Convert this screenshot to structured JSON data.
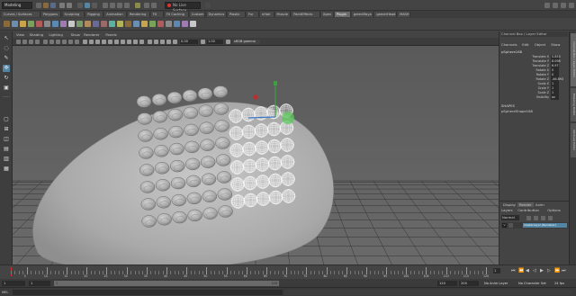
{
  "statusline": {
    "mode": "Modeling",
    "live_surface": "No Live Surface"
  },
  "shelf_tabs": [
    "Curves / Surfaces",
    "Polygons",
    "Sculpting",
    "Rigging",
    "Animation",
    "Rendering",
    "FX",
    "FX Caching",
    "Custom",
    "Dynamics",
    "Plastic",
    "Fur",
    "nHair",
    "Muscle",
    "PaintEffects",
    "Xgen",
    "Plugin",
    "greenMaya",
    "gamerHead",
    "MASH"
  ],
  "panel_menu": [
    "View",
    "Shading",
    "Lighting",
    "Show",
    "Renderer",
    "Panels"
  ],
  "panel_bar": {
    "value_a": "0.00",
    "value_b": "1.00",
    "color_space": "sRGB gamma"
  },
  "channel_box": {
    "header_title": "Channel Box / Layer Editor",
    "menus": [
      "Channels",
      "Edit",
      "Object",
      "Show"
    ],
    "object_name": "pSphere168",
    "attributes": [
      {
        "label": "Translate X",
        "value": "5.853"
      },
      {
        "label": "Translate Y",
        "value": "8.098"
      },
      {
        "label": "Translate Z",
        "value": "6.97"
      },
      {
        "label": "Rotate X",
        "value": "0"
      },
      {
        "label": "Rotate Y",
        "value": "0"
      },
      {
        "label": "Rotate Z",
        "value": "-46.893"
      },
      {
        "label": "Scale X",
        "value": "1"
      },
      {
        "label": "Scale Y",
        "value": "1"
      },
      {
        "label": "Scale Z",
        "value": "1"
      },
      {
        "label": "Visibility",
        "value": "on"
      }
    ],
    "shapes_label": "SHAPES",
    "shape_name": "pSphereShape168"
  },
  "layer_editor": {
    "tabs": [
      "Display",
      "Render",
      "Anim"
    ],
    "menus": [
      "Layers",
      "Contribution",
      "Options"
    ],
    "blend_mode": "Normal",
    "layer_name": "masterLayer (Renderer)"
  },
  "side_tabs": [
    "Channel Box / Layer Editor",
    "Modeling Toolkit",
    "Attribute Editor"
  ],
  "time_slider": {
    "ticks": [
      "5",
      "10",
      "15",
      "20",
      "25",
      "30",
      "35",
      "40",
      "45",
      "50",
      "55",
      "60",
      "65",
      "70",
      "75",
      "80",
      "85",
      "90",
      "95",
      "100",
      "105",
      "110",
      "115",
      "120"
    ],
    "current_frame": "1"
  },
  "range_slider": {
    "start": "1",
    "inner_start": "1",
    "range_start": "1",
    "range_end": "120",
    "inner_end": "120",
    "end": "200",
    "anim_layer": "No Anim Layer",
    "char_set": "No Character Set",
    "fps": "24 fps"
  },
  "cmdline": {
    "label": "MEL"
  },
  "colors": {
    "accent": "#5285a6",
    "active_tab": "#6a6a6a",
    "grid": "#333333",
    "y_axis": "#3ca03c",
    "x_axis": "#b43232",
    "manip_z": "#3c78c8"
  }
}
